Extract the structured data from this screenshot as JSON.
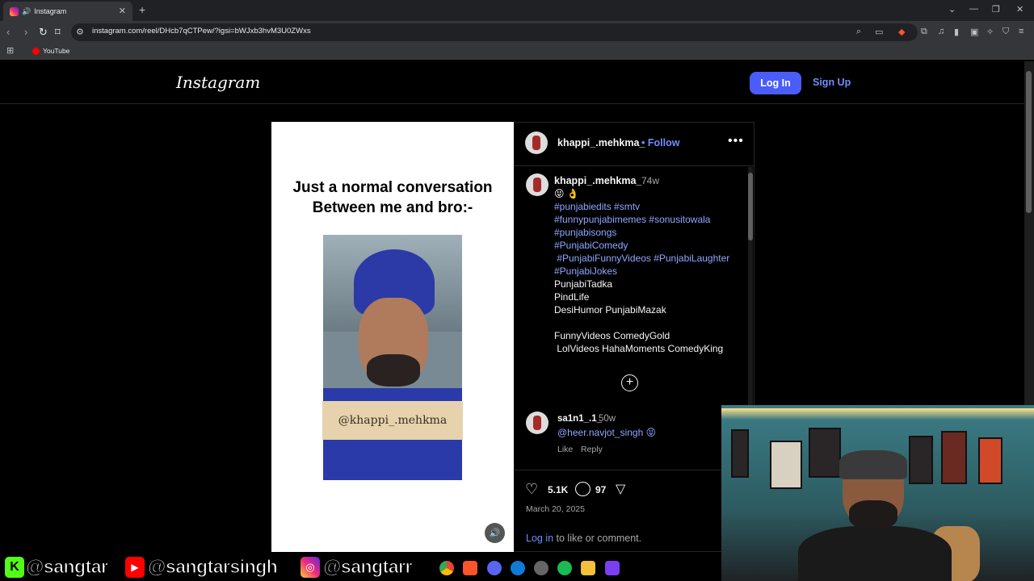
{
  "browser": {
    "tab_title": "Instagram",
    "tab_audio_icon": "speaker-icon",
    "new_tab": "+",
    "url": "instagram.com/reel/DHcb7qCTPew/?igsi=bWJxb3hvM3U0ZWxs",
    "bookmark_youtube": "YouTube",
    "window_controls": [
      "⌄",
      "—",
      "❐",
      "✕"
    ]
  },
  "instagram": {
    "logo": "Instagram",
    "login_button": "Log In",
    "signup_link": "Sign Up",
    "reel": {
      "caption_line1": "Just a normal conversation",
      "caption_line2": "Between me and bro:-",
      "watermark": "@khappi_.mehkma"
    },
    "post": {
      "username": "khappi_.mehkma_",
      "follow": "• Follow",
      "more": "•••",
      "caption_user": "khappi_.mehkma_",
      "caption_time": "74w",
      "caption_emoji": "😝 👌",
      "caption_lines": [
        {
          "text": "#punjabiedits #smtv",
          "tag": true
        },
        {
          "text": "#funnypunjabimemes #sonusitowala",
          "tag": true
        },
        {
          "text": "#punjabisongs",
          "tag": true
        },
        {
          "text": "#PunjabiComedy",
          "tag": true
        },
        {
          "text": " #PunjabiFunnyVideos #PunjabiLaughter",
          "tag": true
        },
        {
          "text": "#PunjabiJokes",
          "tag": true
        },
        {
          "text": "PunjabiTadka",
          "tag": false
        },
        {
          "text": "PindLife",
          "tag": false
        },
        {
          "text": "DesiHumor PunjabiMazak",
          "tag": false
        },
        {
          "text": "FunnyVideos ComedyGold",
          "tag": false
        },
        {
          "text": " LolVideos HahaMoments ComedyKing",
          "tag": false
        }
      ],
      "comment": {
        "user": "sa1n1_.1_",
        "time": "50w",
        "text": "@heer.navjot_singh 😝",
        "like": "Like",
        "reply": "Reply"
      },
      "likes": "5.1K",
      "comments": "97",
      "date": "March 20, 2025",
      "login_link": "Log in",
      "login_suffix": " to like or comment."
    }
  },
  "stream_overlay": {
    "kick_handle": "@sangtar",
    "youtube_handle": "@sangtarsingh",
    "instagram_handle": "@sangtarr"
  },
  "colors": {
    "accent_blue": "#4a5df9",
    "link_blue": "#6e8eff",
    "hashtag_blue": "#8fa7ff",
    "kick_green": "#53fc18",
    "youtube_red": "#ff0000"
  }
}
